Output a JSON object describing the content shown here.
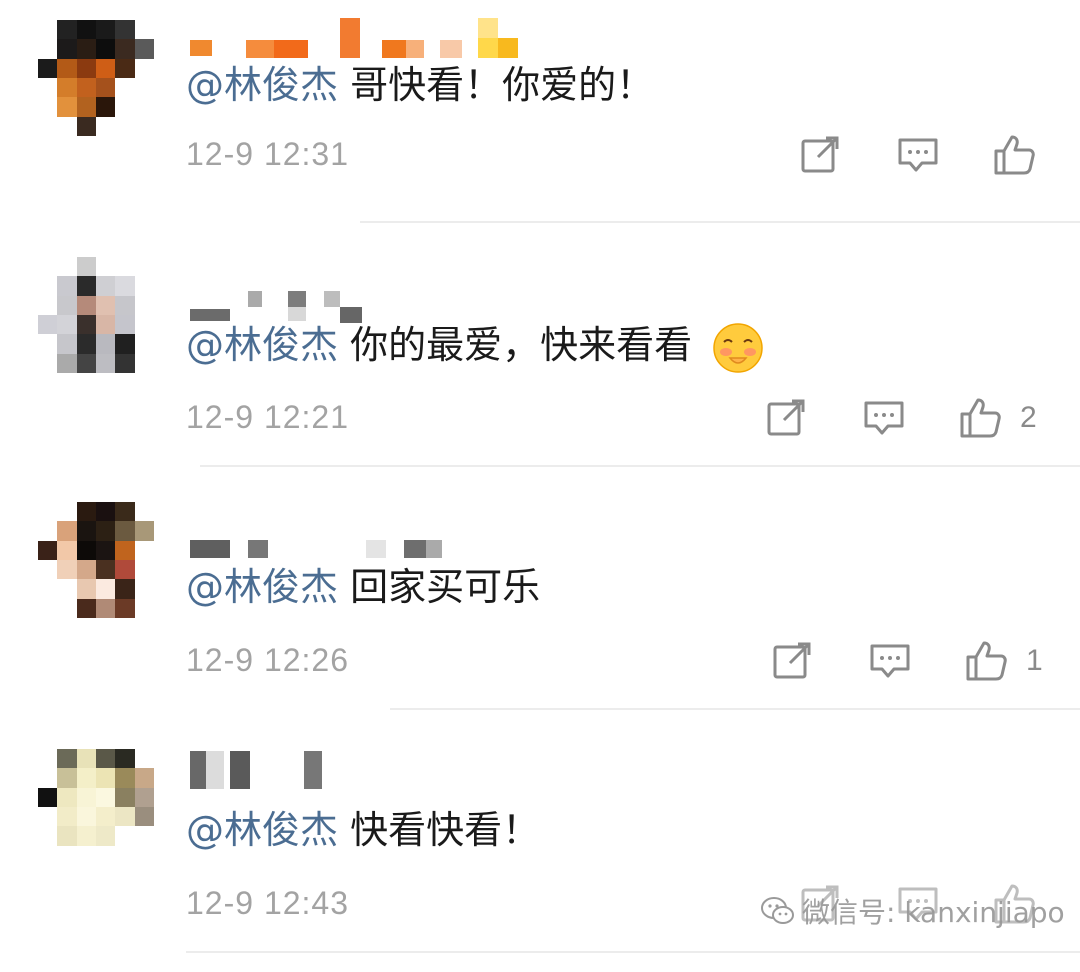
{
  "mention": "@林俊杰",
  "comments": [
    {
      "text": "哥快看！你爱的！",
      "time": "12-9 12:31",
      "likes": ""
    },
    {
      "text": "你的最爱，快来看看",
      "time": "12-9 12:21",
      "likes": "2"
    },
    {
      "text": "回家买可乐",
      "time": "12-9 12:26",
      "likes": "1"
    },
    {
      "text": "快看快看！",
      "time": "12-9 12:43",
      "likes": ""
    }
  ],
  "icons": {
    "share": "share-icon",
    "reply": "comment-icon",
    "like": "thumbs-up-icon",
    "emoji": "blushing-face-icon"
  },
  "colors": {
    "mention": "#4b6d92",
    "text": "#1a1a1a",
    "meta": "#a3a3a3"
  },
  "watermark": "微信号: kanxinjiapo"
}
